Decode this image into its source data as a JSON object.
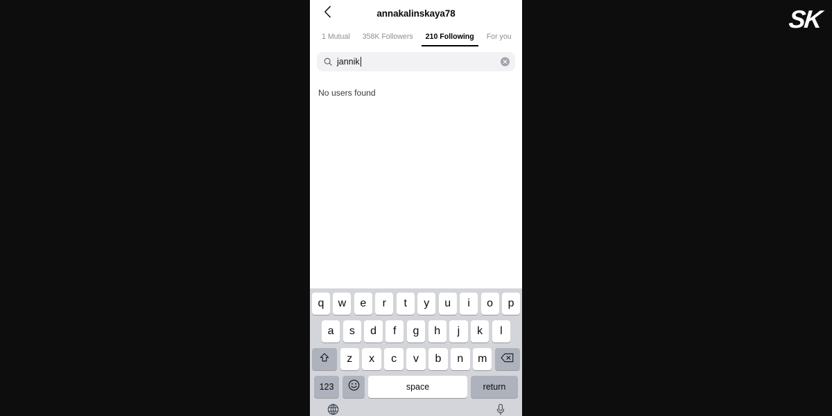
{
  "watermark": {
    "label": "SK"
  },
  "navbar": {
    "title": "annakalinskaya78",
    "back_icon": "chevron-left-icon"
  },
  "tabs": [
    {
      "label": "1 Mutual",
      "active": false
    },
    {
      "label": "358K Followers",
      "active": false
    },
    {
      "label": "210 Following",
      "active": true
    },
    {
      "label": "For you",
      "active": false
    }
  ],
  "search": {
    "value": "jannik",
    "placeholder": "Search",
    "icon": "search-icon",
    "clear_icon": "clear-circle-icon"
  },
  "results": {
    "empty_message": "No users found"
  },
  "keyboard": {
    "row1": [
      "q",
      "w",
      "e",
      "r",
      "t",
      "y",
      "u",
      "i",
      "o",
      "p"
    ],
    "row2": [
      "a",
      "s",
      "d",
      "f",
      "g",
      "h",
      "j",
      "k",
      "l"
    ],
    "row3": [
      "z",
      "x",
      "c",
      "v",
      "b",
      "n",
      "m"
    ],
    "shift_icon": "shift-arrow-icon",
    "backspace_icon": "backspace-icon",
    "numbers_label": "123",
    "emoji_icon": "emoji-smiley-icon",
    "space_label": "space",
    "return_label": "return",
    "globe_icon": "globe-icon",
    "mic_icon": "microphone-icon"
  },
  "colors": {
    "background": "#0d0d0d",
    "screen": "#ffffff",
    "accent": "#000000",
    "muted_text": "#8e8e93",
    "search_field": "#f2f2f4",
    "keyboard_bg": "#d3d5da",
    "key_white": "#ffffff",
    "key_gray": "#aeb2bc"
  }
}
